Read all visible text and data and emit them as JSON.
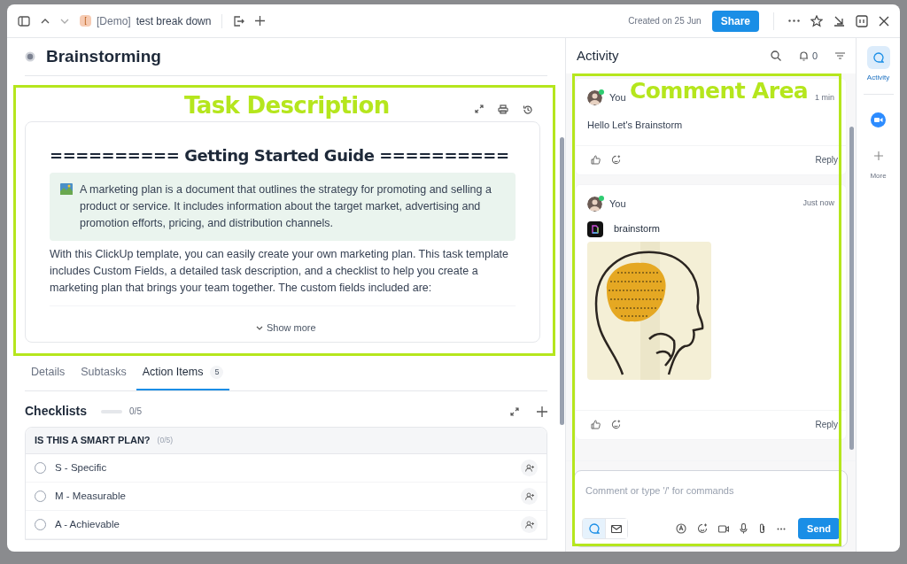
{
  "header": {
    "space_icon": "[",
    "breadcrumb": [
      "[Demo]",
      "test break down"
    ],
    "created": "Created on 25 Jun",
    "share": "Share"
  },
  "task": {
    "title": "Brainstorming"
  },
  "description": {
    "annotation": "Task Description",
    "heading": "========== Getting Started Guide ==========",
    "callout": "A marketing plan is a document that outlines the strategy for promoting and selling a product or service. It includes information about the target market, advertising and promotion efforts, pricing, and distribution channels.",
    "paragraph": "With this ClickUp template, you can easily create your own marketing plan. This task template includes Custom Fields, a detailed task description, and a checklist to help you create a marketing plan that brings your team together. The custom fields included are:",
    "show_more": "Show more"
  },
  "tabs": [
    {
      "label": "Details",
      "selected": false
    },
    {
      "label": "Subtasks",
      "selected": false
    },
    {
      "label": "Action Items",
      "count": "5",
      "selected": true
    }
  ],
  "checklists": {
    "title": "Checklists",
    "level": 0,
    "progress": "0/5",
    "group": {
      "title": "IS THIS A SMART PLAN?",
      "count": "(0/5)"
    },
    "items": [
      {
        "text": "S - Specific",
        "checked": false
      },
      {
        "text": "M - Measurable",
        "checked": false
      },
      {
        "text": "A - Achievable",
        "checked": false
      }
    ]
  },
  "activity": {
    "title": "Activity",
    "annotation": "Comment Area",
    "notifications": "0",
    "comments": [
      {
        "kind": "text",
        "author": "You",
        "online": true,
        "time": "1 min",
        "text": "Hello Let's Brainstorm",
        "reply": "Reply"
      },
      {
        "kind": "attachment",
        "author": "You",
        "online": true,
        "time": "Just now",
        "file": "brainstorm",
        "reply": "Reply"
      }
    ],
    "composer": {
      "placeholder": "Comment or type '/' for commands",
      "modes": [
        {
          "kind": "comment",
          "selected": true
        },
        {
          "kind": "email",
          "selected": false
        }
      ],
      "send": "Send"
    }
  },
  "rail": [
    {
      "kind": "activity",
      "label": "Activity",
      "selected": true
    },
    {
      "kind": "video",
      "selected": false
    },
    {
      "kind": "more",
      "label": "More",
      "selected": false
    }
  ]
}
